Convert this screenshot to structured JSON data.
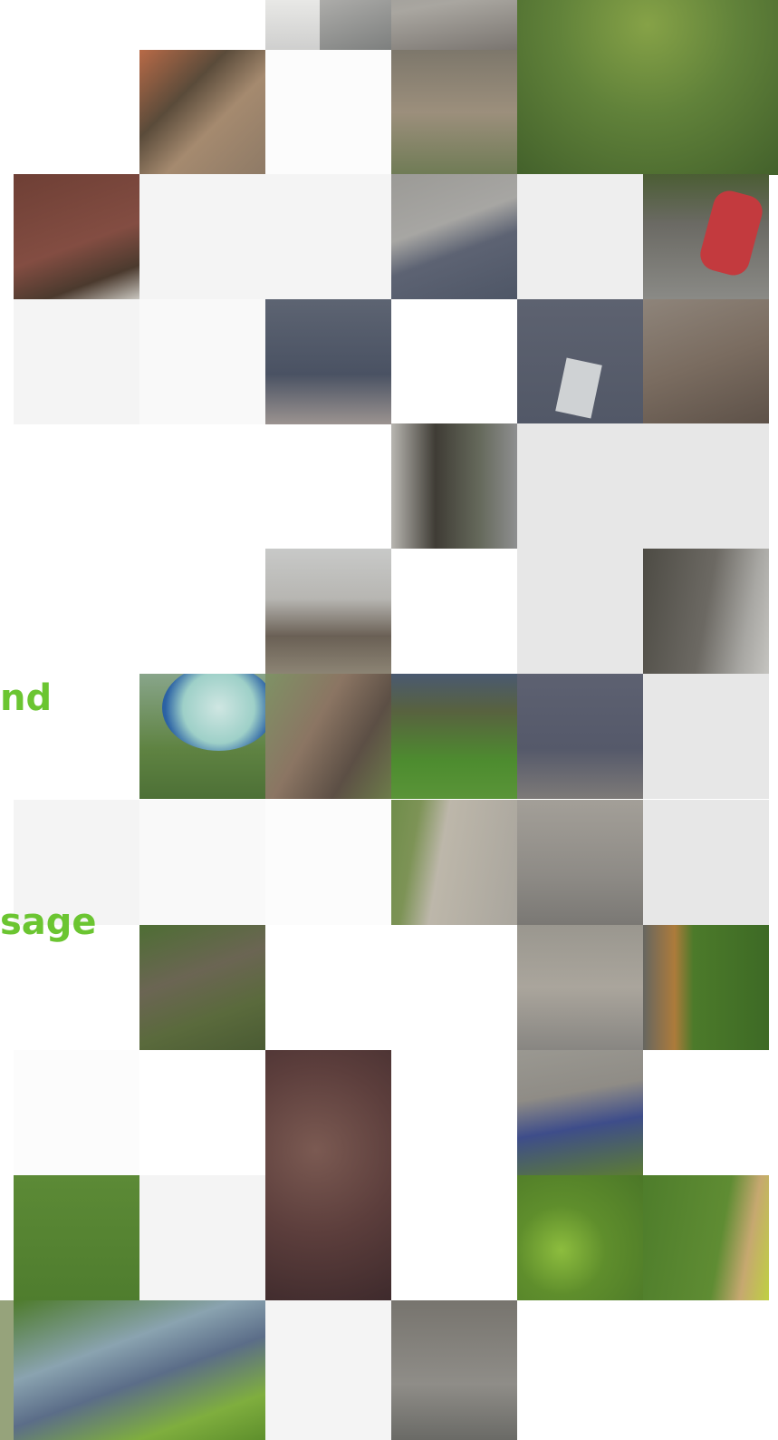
{
  "headings": [
    "nd",
    "sage"
  ],
  "colors": {
    "heading": "#6bc531",
    "background": "#ffffff"
  },
  "tiles": [
    {
      "id": "street-car-road",
      "style": "photo-road"
    },
    {
      "id": "tree-canopy-top",
      "style": "photo-tree"
    },
    {
      "id": "terrace-rooftops-red",
      "style": "photo-roof-red"
    },
    {
      "id": "terrace-rooftops-grey",
      "style": "photo-roof-grey"
    },
    {
      "id": "flat-roof-skylight",
      "style": "photo-skylight"
    },
    {
      "id": "yard-narrow-path",
      "style": "photo-yard"
    },
    {
      "id": "rear-extension",
      "style": "photo-extension"
    },
    {
      "id": "patio-clutter",
      "style": "photo-patio"
    },
    {
      "id": "paddling-pool",
      "style": "photo-pool"
    },
    {
      "id": "garden-lawn-mid",
      "style": "photo-lawn"
    },
    {
      "id": "shed-roof-dark",
      "style": "photo-shed"
    },
    {
      "id": "paved-yard",
      "style": "photo-paved"
    },
    {
      "id": "garden-raised-beds",
      "style": "photo-beds"
    },
    {
      "id": "hedge-green",
      "style": "photo-hedge"
    },
    {
      "id": "copper-beech-tree",
      "style": "photo-beech"
    },
    {
      "id": "blue-shed-roof",
      "style": "photo-blueshed"
    },
    {
      "id": "lawn-large",
      "style": "photo-lawn2"
    },
    {
      "id": "greenhouse-roof",
      "style": "photo-greenhouse"
    },
    {
      "id": "bushes-bottom",
      "style": "photo-bush"
    }
  ]
}
